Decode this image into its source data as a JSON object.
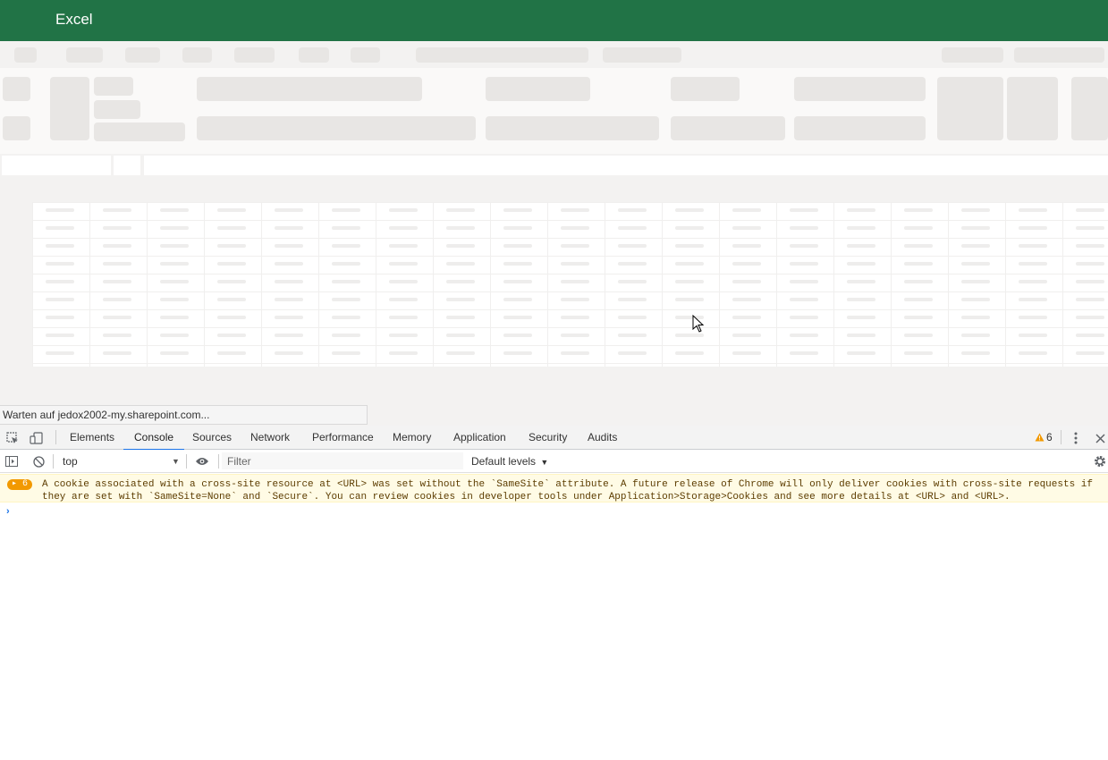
{
  "excel": {
    "app_title": "Excel",
    "status_text": "Warten auf jedox2002-my.sharepoint.com..."
  },
  "devtools": {
    "tabs": [
      {
        "label": "Elements"
      },
      {
        "label": "Console"
      },
      {
        "label": "Sources"
      },
      {
        "label": "Network"
      },
      {
        "label": "Performance"
      },
      {
        "label": "Memory"
      },
      {
        "label": "Application"
      },
      {
        "label": "Security"
      },
      {
        "label": "Audits"
      }
    ],
    "active_tab": "Console",
    "warning_count": "6",
    "console": {
      "context": "top",
      "filter_placeholder": "Filter",
      "levels_label": "Default levels",
      "message_count": "6",
      "message_text": "A cookie associated with a cross-site resource at <URL> was set without the `SameSite` attribute. A future release of Chrome will only deliver cookies with cross-site requests if they are set with `SameSite=None` and `Secure`. You can review cookies in developer tools under Application>Storage>Cookies and see more details at <URL> and <URL>.",
      "prompt_symbol": "›"
    }
  },
  "colors": {
    "excel_green": "#217346",
    "devtools_active_tab": "#1a73e8",
    "warning_badge": "#f29900"
  }
}
